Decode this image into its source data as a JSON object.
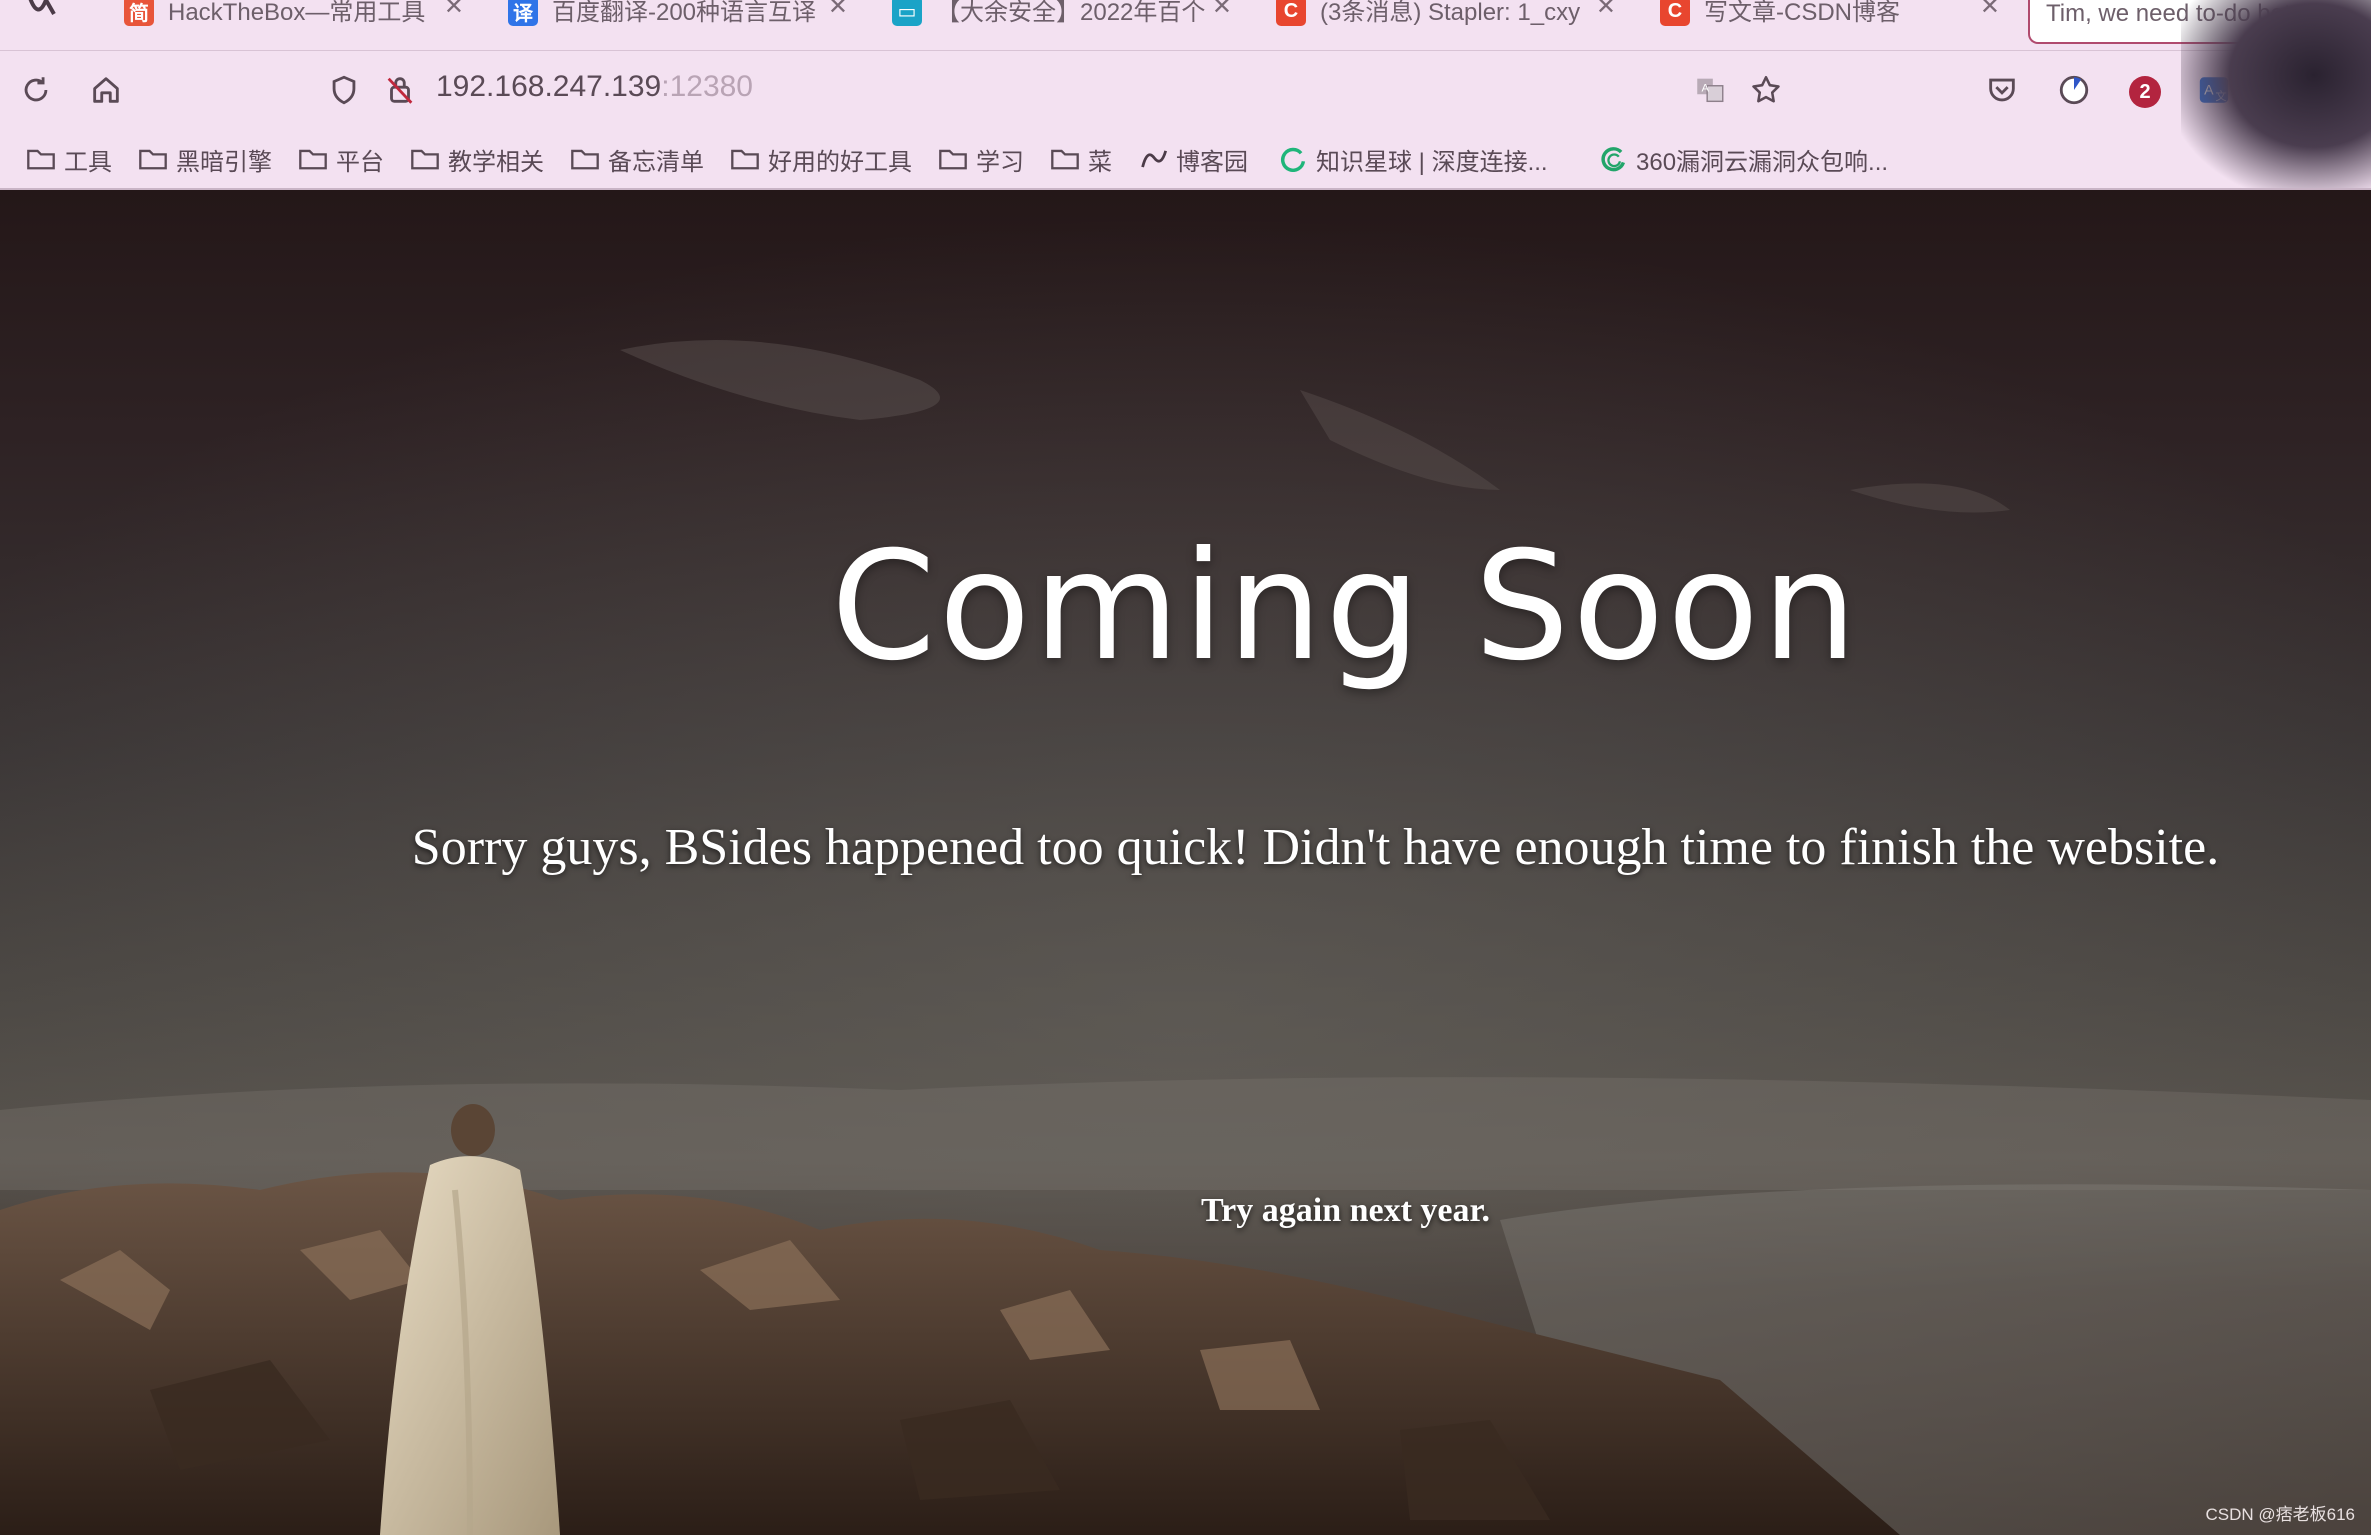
{
  "tabs": [
    {
      "title": "HackTheBox—常用工具",
      "favicon_text": "简",
      "favicon_color": "#e8553a"
    },
    {
      "title": "百度翻译-200种语言互译",
      "favicon_text": "译",
      "favicon_color": "#2f74e8"
    },
    {
      "title": "【大余安全】2022年百个",
      "favicon_text": "▭",
      "favicon_color": "#1aa3c7"
    },
    {
      "title": "(3条消息) Stapler: 1_cxy",
      "favicon_text": "C",
      "favicon_color": "#e8462f"
    },
    {
      "title": "写文章-CSDN博客",
      "favicon_text": "C",
      "favicon_color": "#e8462f"
    },
    {
      "title": "Tim, we need to-do better",
      "favicon_text": "",
      "favicon_color": "#ffffff"
    }
  ],
  "address": {
    "host": "192.168.247.139",
    "port": ":12380"
  },
  "toolbar": {
    "notification_count": "2"
  },
  "bookmarks": [
    {
      "label": "工具",
      "icon": "folder-icon"
    },
    {
      "label": "黑暗引擎",
      "icon": "folder-icon"
    },
    {
      "label": "平台",
      "icon": "folder-icon"
    },
    {
      "label": "教学相关",
      "icon": "folder-icon"
    },
    {
      "label": "备忘清单",
      "icon": "folder-icon"
    },
    {
      "label": "好用的好工具",
      "icon": "folder-icon"
    },
    {
      "label": "学习",
      "icon": "folder-icon"
    },
    {
      "label": "菜",
      "icon": "folder-icon"
    },
    {
      "label": "博客园",
      "icon": "cnblogs-icon"
    },
    {
      "label": "知识星球 | 深度连接...",
      "icon": "zsxq-icon"
    },
    {
      "label": "360漏洞云漏洞众包响...",
      "icon": "360-icon"
    }
  ],
  "page": {
    "headline": "Coming Soon",
    "subtitle": "Sorry guys, BSides happened too quick! Didn't have enough time to finish the website.",
    "footer_note": "Try again next year."
  },
  "watermark": "CSDN @痞老板616",
  "colors": {
    "chrome_bg": "#f3e1f1",
    "active_tab_border": "#b04a6e",
    "badge": "#b3243f"
  }
}
